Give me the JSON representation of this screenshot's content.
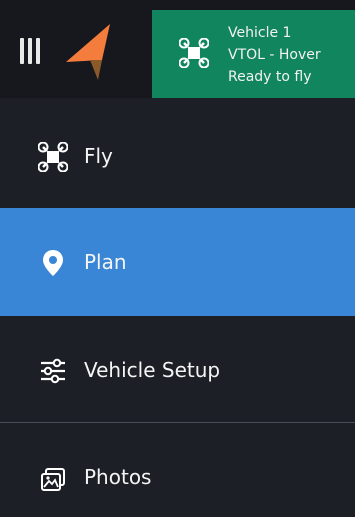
{
  "vehicle": {
    "name": "Vehicle 1",
    "mode": "VTOL - Hover",
    "status": "Ready to fly"
  },
  "nav": {
    "items": [
      {
        "label": "Fly",
        "icon": "drone-icon",
        "active": false
      },
      {
        "label": "Plan",
        "icon": "location-pin-icon",
        "active": true
      },
      {
        "label": "Vehicle Setup",
        "icon": "sliders-icon",
        "active": false
      },
      {
        "label": "Photos",
        "icon": "photos-icon",
        "active": false
      }
    ]
  },
  "colors": {
    "header_bg": "#16181d",
    "panel_bg": "#1c1f26",
    "status_green": "#11855e",
    "active_blue": "#3a86d6",
    "logo_orange": "#f47c3c",
    "logo_brown": "#8a5a2b"
  }
}
